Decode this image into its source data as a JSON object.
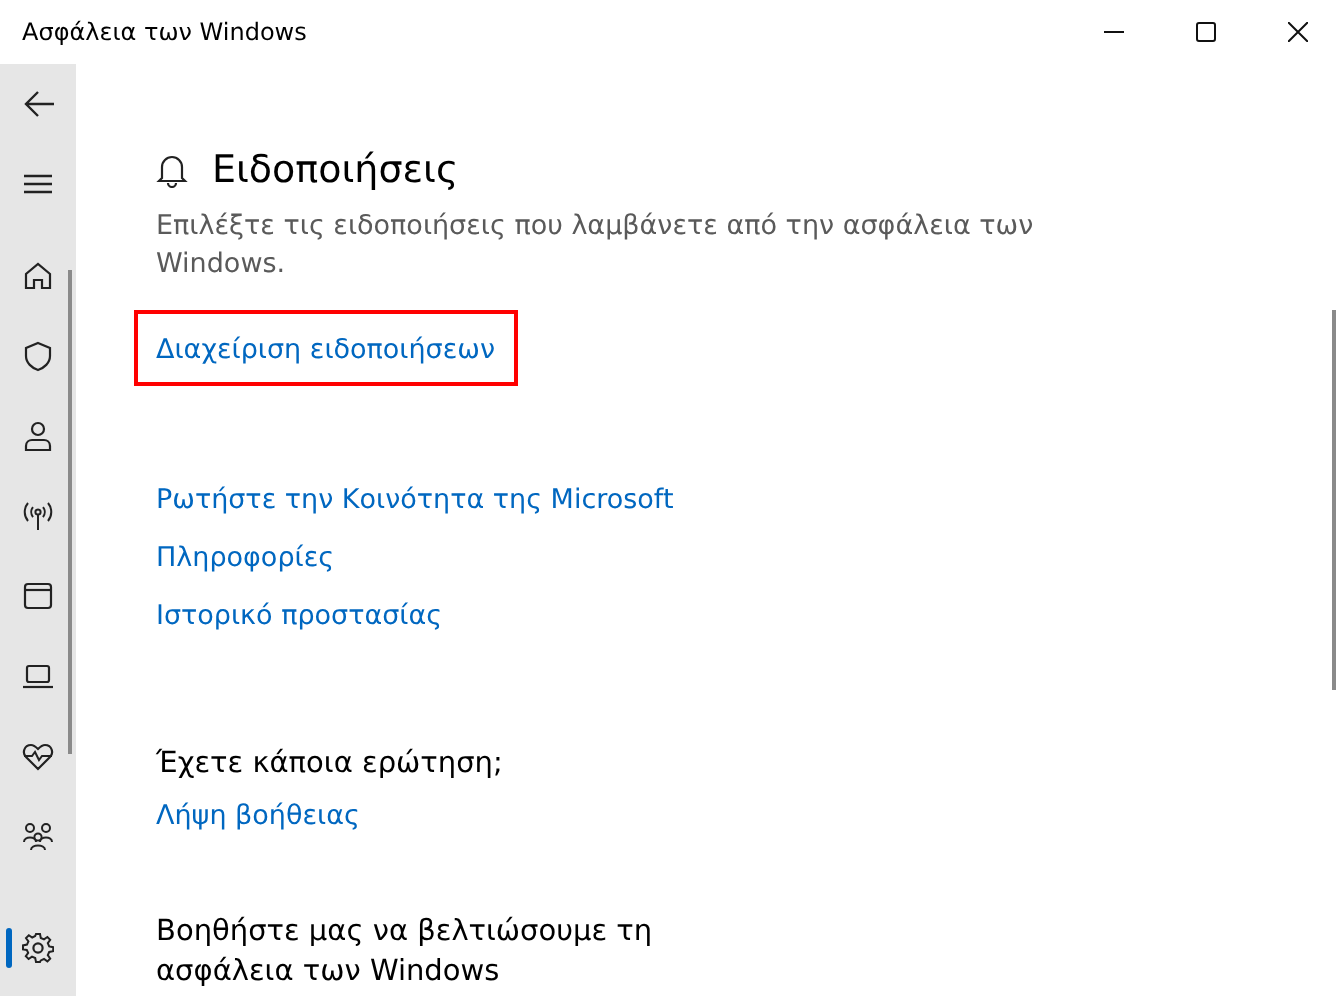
{
  "window": {
    "title": "Ασφάλεια των Windows"
  },
  "sidebar": {
    "items": [
      {
        "kind": "back",
        "selected": false
      },
      {
        "kind": "menu",
        "selected": false
      },
      {
        "kind": "home",
        "selected": false
      },
      {
        "kind": "shield",
        "selected": false
      },
      {
        "kind": "person",
        "selected": false
      },
      {
        "kind": "antenna",
        "selected": false
      },
      {
        "kind": "window",
        "selected": false
      },
      {
        "kind": "laptop",
        "selected": false
      },
      {
        "kind": "heart",
        "selected": false
      },
      {
        "kind": "family",
        "selected": false
      },
      {
        "kind": "gear",
        "selected": true
      }
    ]
  },
  "notifications": {
    "title": "Ειδοποιήσεις",
    "description": "Επιλέξτε τις ειδοποιήσεις που λαμβάνετε από την ασφάλεια των Windows.",
    "link": {
      "label": "Διαχείριση ειδοποιήσεων",
      "highlighted": true
    }
  },
  "links": [
    "Ρωτήστε την Κοινότητα της Microsoft",
    "Πληροφορίες",
    "Ιστορικό προστασίας"
  ],
  "question": {
    "title": "Έχετε κάποια ερώτηση;",
    "link": "Λήψη βοήθειας"
  },
  "improve": {
    "title": "Βοηθήστε μας να βελτιώσουμε τη ασφάλεια των Windows"
  }
}
